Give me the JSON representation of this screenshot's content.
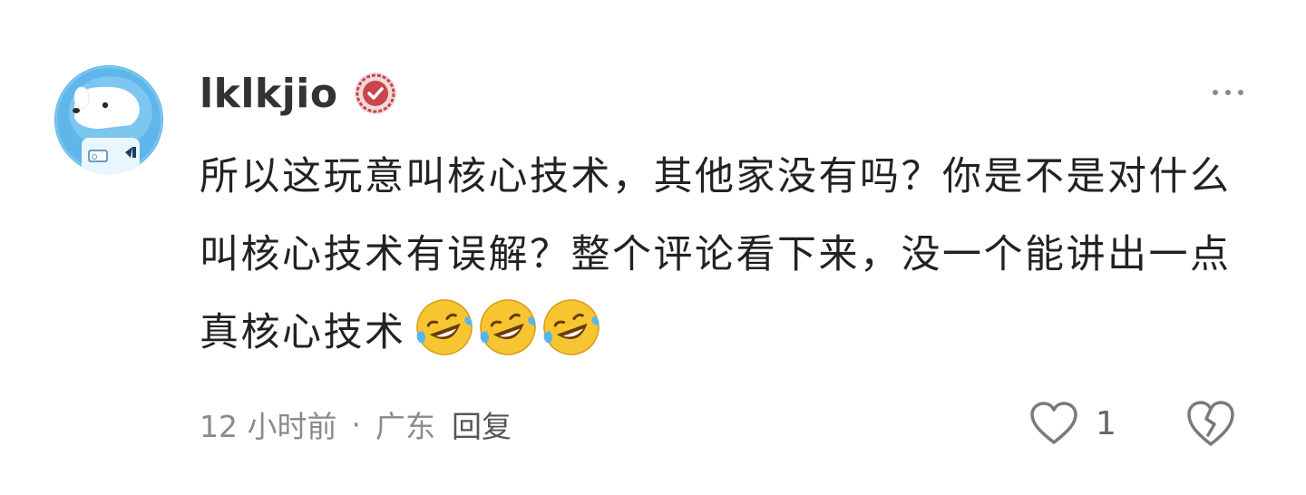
{
  "comment": {
    "username": "lklkjio",
    "text": "所以这玩意叫核心技术，其他家没有吗？你是不是对什么叫核心技术有误解？整个评论看下来，没一个能讲出一点真核心技术",
    "emojis": [
      "laughing-crying-emoji",
      "laughing-crying-emoji",
      "laughing-crying-emoji"
    ],
    "time": "12 小时前",
    "separator": "·",
    "location": "广东",
    "reply_label": "回复",
    "like_count": "1"
  },
  "icons": {
    "verified": "verified-badge-icon",
    "more": "more-icon",
    "like": "heart-icon",
    "dislike": "broken-heart-icon"
  },
  "colors": {
    "username": "#333333",
    "text": "#222222",
    "meta": "#8a8a8a",
    "verified_badge": "#c8464c",
    "avatar_bg": "#5fb6ea"
  }
}
